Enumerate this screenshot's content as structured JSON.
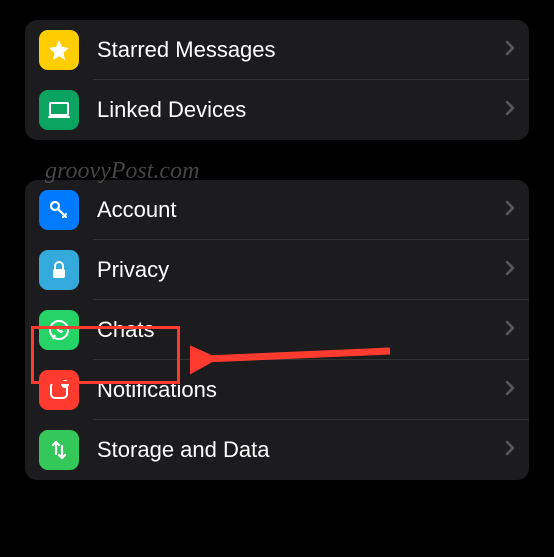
{
  "groups": [
    {
      "items": [
        {
          "label": "Starred Messages",
          "icon": "star-icon",
          "bg": "#ffcc00"
        },
        {
          "label": "Linked Devices",
          "icon": "laptop-icon",
          "bg": "#0ba360"
        }
      ]
    },
    {
      "items": [
        {
          "label": "Account",
          "icon": "key-icon",
          "bg": "#007aff"
        },
        {
          "label": "Privacy",
          "icon": "lock-icon",
          "bg": "#34aadc"
        },
        {
          "label": "Chats",
          "icon": "whatsapp-icon",
          "bg": "#25d366"
        },
        {
          "label": "Notifications",
          "icon": "notification-icon",
          "bg": "#ff3b30"
        },
        {
          "label": "Storage and Data",
          "icon": "arrows-icon",
          "bg": "#34c759"
        }
      ]
    }
  ],
  "watermark": "groovyPost.com",
  "highlighted_item": "Chats"
}
